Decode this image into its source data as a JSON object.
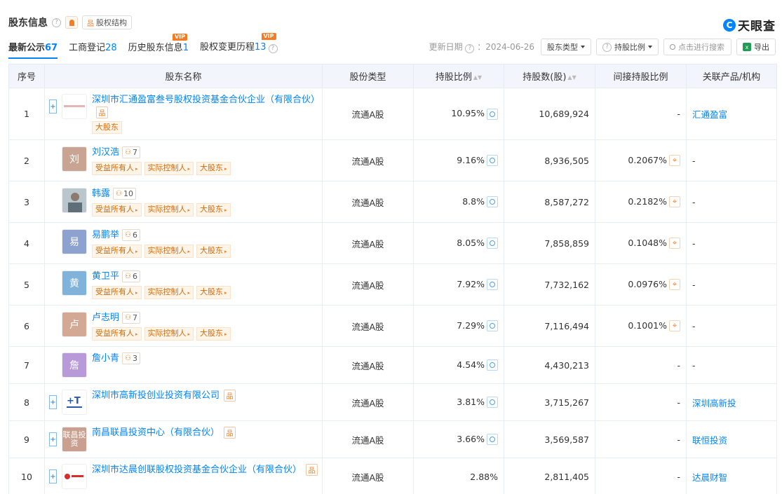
{
  "header": {
    "title": "股东信息",
    "equity_structure_label": "股权结构",
    "brand": "天眼查",
    "brand_mark": "C"
  },
  "tabs": [
    {
      "label": "最新公示",
      "count": "67",
      "vip": false,
      "active": true
    },
    {
      "label": "工商登记",
      "count": "28",
      "vip": false,
      "active": false
    },
    {
      "label": "历史股东信息",
      "count": "1",
      "vip": true,
      "active": false
    },
    {
      "label": "股权变更历程",
      "count": "13",
      "vip": true,
      "active": false
    }
  ],
  "vip_label": "VIP",
  "toolbar": {
    "update_label": "更新日期",
    "update_date": "：2024-06-26",
    "shareholder_type_label": "股东类型",
    "holding_ratio_label": "持股比例",
    "search_placeholder": "点击进行搜索",
    "export_label": "导出"
  },
  "table": {
    "headers": [
      "序号",
      "股东名称",
      "股份类型",
      "持股比例",
      "持股数(股)",
      "间接持股比例",
      "关联产品/机构"
    ],
    "rows": [
      {
        "idx": "1",
        "name": "深圳市汇通盈富叁号股权投资基金合伙企业（有限合伙）",
        "avatar": "",
        "avatar_color": "#ffffff",
        "logo": "bar",
        "expand": true,
        "person_count": "",
        "org": true,
        "tags": [
          "大股东"
        ],
        "share_type": "流通A股",
        "ratio": "10.95%",
        "shares": "10,689,924",
        "indirect": "-",
        "related": "汇通盈富",
        "related_link": true
      },
      {
        "idx": "2",
        "name": "刘汉浩",
        "avatar": "刘",
        "avatar_color": "#c9a493",
        "logo": "",
        "expand": false,
        "person_count": "7",
        "org": false,
        "tags": [
          "受益所有人",
          "实际控制人",
          "大股东"
        ],
        "share_type": "流通A股",
        "ratio": "9.16%",
        "shares": "8,936,505",
        "indirect": "0.2067%",
        "related": "-",
        "related_link": false
      },
      {
        "idx": "3",
        "name": "韩露",
        "avatar": "",
        "avatar_color": "#8da3a8",
        "logo": "photo",
        "expand": false,
        "person_count": "10",
        "org": false,
        "tags": [
          "受益所有人",
          "实际控制人",
          "大股东"
        ],
        "share_type": "流通A股",
        "ratio": "8.8%",
        "shares": "8,587,272",
        "indirect": "0.2182%",
        "related": "-",
        "related_link": false
      },
      {
        "idx": "4",
        "name": "易鹏举",
        "avatar": "易",
        "avatar_color": "#8ea2d0",
        "logo": "",
        "expand": false,
        "person_count": "6",
        "org": false,
        "tags": [
          "受益所有人",
          "实际控制人",
          "大股东"
        ],
        "share_type": "流通A股",
        "ratio": "8.05%",
        "shares": "7,858,859",
        "indirect": "0.1048%",
        "related": "-",
        "related_link": false
      },
      {
        "idx": "5",
        "name": "黄卫平",
        "avatar": "黄",
        "avatar_color": "#7fb3dc",
        "logo": "",
        "expand": false,
        "person_count": "6",
        "org": false,
        "tags": [
          "受益所有人",
          "实际控制人",
          "大股东"
        ],
        "share_type": "流通A股",
        "ratio": "7.92%",
        "shares": "7,732,162",
        "indirect": "0.0976%",
        "related": "-",
        "related_link": false
      },
      {
        "idx": "6",
        "name": "卢志明",
        "avatar": "卢",
        "avatar_color": "#d3a996",
        "logo": "",
        "expand": false,
        "person_count": "7",
        "org": false,
        "tags": [
          "受益所有人",
          "实际控制人",
          "大股东"
        ],
        "share_type": "流通A股",
        "ratio": "7.29%",
        "shares": "7,116,494",
        "indirect": "0.1001%",
        "related": "-",
        "related_link": false
      },
      {
        "idx": "7",
        "name": "詹小青",
        "avatar": "詹",
        "avatar_color": "#b89ad8",
        "logo": "",
        "expand": false,
        "person_count": "3",
        "org": false,
        "tags": [],
        "share_type": "流通A股",
        "ratio": "4.54%",
        "shares": "4,430,213",
        "indirect": "-",
        "related": "-",
        "related_link": false
      },
      {
        "idx": "8",
        "name": "深圳市高新投创业投资有限公司",
        "avatar": "",
        "avatar_color": "#ffffff",
        "logo": "gxt",
        "expand": true,
        "person_count": "",
        "org": true,
        "tags": [],
        "share_type": "流通A股",
        "ratio": "3.81%",
        "shares": "3,715,267",
        "indirect": "-",
        "related": "深圳高新投",
        "related_link": true
      },
      {
        "idx": "9",
        "name": "南昌联昌投资中心（有限合伙）",
        "avatar": "联昌投资",
        "avatar_color": "#c9a090",
        "logo": "",
        "expand": true,
        "person_count": "",
        "org": true,
        "tags": [],
        "share_type": "流通A股",
        "ratio": "3.66%",
        "shares": "3,569,587",
        "indirect": "-",
        "related": "联恒投资",
        "related_link": true
      },
      {
        "idx": "10",
        "name": "深圳市达晨创联股权投资基金合伙企业（有限合伙）",
        "avatar": "",
        "avatar_color": "#ffffff",
        "logo": "dc",
        "expand": true,
        "person_count": "",
        "org": true,
        "tags": [],
        "share_type": "流通A股",
        "ratio": "2.88%",
        "shares": "2,811,405",
        "indirect": "-",
        "related": "达晨财智",
        "related_link": true
      }
    ]
  }
}
